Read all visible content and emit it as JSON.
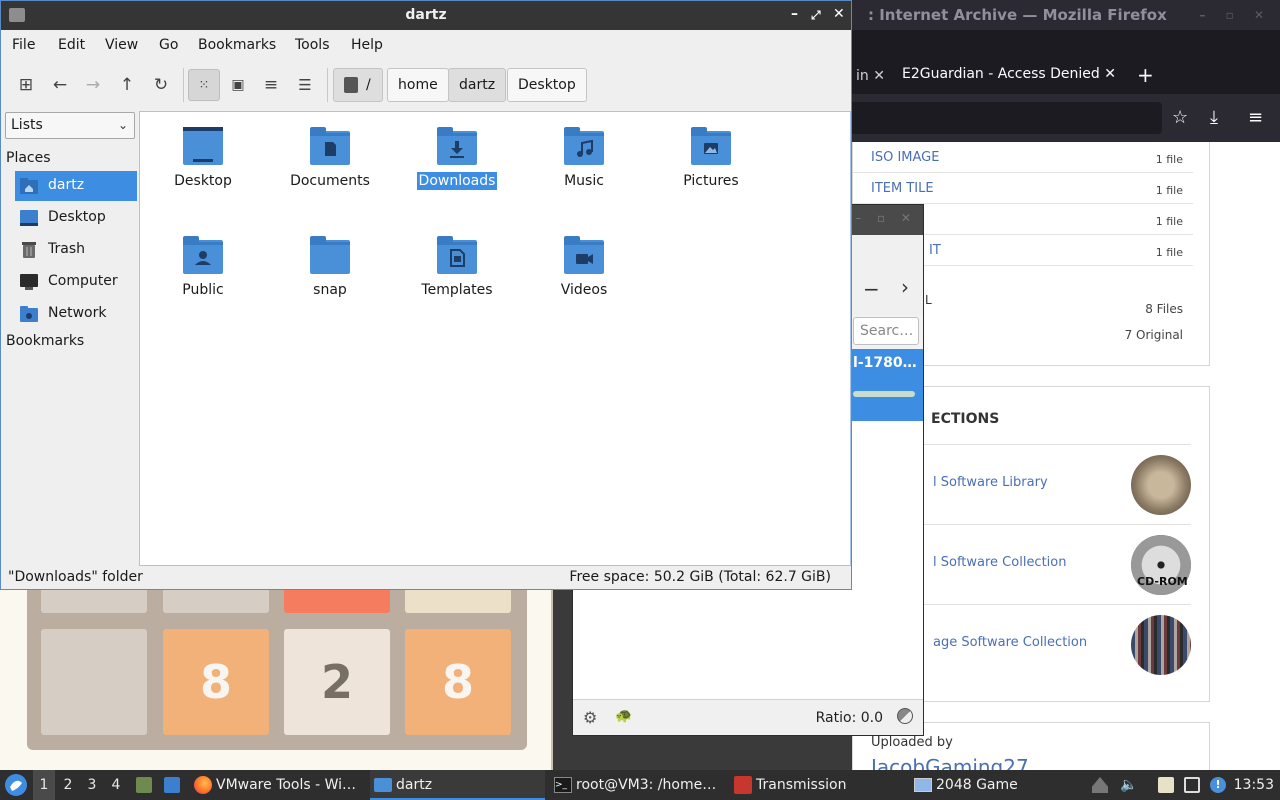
{
  "firefox": {
    "title": ": Internet Archive — Mozilla Firefox",
    "tab_prev_label": "in",
    "tab_active_label": "E2Guardian - Access Denied",
    "new_tab_glyph": "+",
    "files": [
      {
        "name": "ISO IMAGE",
        "count": "1 file"
      },
      {
        "name": "ITEM TILE",
        "count": "1 file"
      },
      {
        "name": "",
        "count": "1 file"
      },
      {
        "name": "IT",
        "count": "1 file"
      }
    ],
    "files_total_label": "L",
    "files_total": "8 Files",
    "files_original": "7 Original",
    "collections_title": "ECTIONS",
    "collections": [
      {
        "name": "l Software Library"
      },
      {
        "name": "l Software Collection"
      },
      {
        "name": "age Software Collection"
      }
    ],
    "cdrom_label": "CD-ROM",
    "uploaded_by_label": "Uploaded by",
    "uploader": "JacobGaming27"
  },
  "transmission": {
    "search_placeholder": "Searc…",
    "torrent_name": "l-1780…",
    "torrent_progress": 1.0,
    "ratio_text": "Ratio: 0.0"
  },
  "game": {
    "tiles_row2": [
      "",
      "8",
      "2",
      "8"
    ]
  },
  "file_manager": {
    "title": "dartz",
    "menu": [
      "File",
      "Edit",
      "View",
      "Go",
      "Bookmarks",
      "Tools",
      "Help"
    ],
    "breadcrumb": [
      "/",
      "home",
      "dartz",
      "Desktop"
    ],
    "side_selector": "Lists",
    "places_heading": "Places",
    "bookmarks_heading": "Bookmarks",
    "places": [
      {
        "label": "dartz",
        "icon": "home-folder-icon",
        "selected": true
      },
      {
        "label": "Desktop",
        "icon": "desktop-icon",
        "selected": false
      },
      {
        "label": "Trash",
        "icon": "trash-icon",
        "selected": false
      },
      {
        "label": "Computer",
        "icon": "computer-icon",
        "selected": false
      },
      {
        "label": "Network",
        "icon": "network-icon",
        "selected": false
      }
    ],
    "folders": [
      {
        "label": "Desktop",
        "icon": "desktop-folder-icon"
      },
      {
        "label": "Documents",
        "icon": "documents-folder-icon"
      },
      {
        "label": "Downloads",
        "icon": "downloads-folder-icon",
        "selected": true
      },
      {
        "label": "Music",
        "icon": "music-folder-icon"
      },
      {
        "label": "Pictures",
        "icon": "pictures-folder-icon"
      },
      {
        "label": "Public",
        "icon": "public-folder-icon"
      },
      {
        "label": "snap",
        "icon": "folder-icon"
      },
      {
        "label": "Templates",
        "icon": "templates-folder-icon"
      },
      {
        "label": "Videos",
        "icon": "videos-folder-icon"
      }
    ],
    "status_left": "\"Downloads\" folder",
    "status_right": "Free space: 50.2 GiB (Total: 62.7 GiB)"
  },
  "taskbar": {
    "workspaces": [
      "1",
      "2",
      "3",
      "4"
    ],
    "tasks": [
      {
        "label": "VMware Tools - Wi…",
        "icon": "firefox-icon"
      },
      {
        "label": "dartz",
        "icon": "folder-icon",
        "active": true
      },
      {
        "label": "root@VM3: /home…",
        "icon": "terminal-icon"
      },
      {
        "label": "Transmission",
        "icon": "transmission-icon"
      },
      {
        "label": "2048 Game",
        "icon": "window-icon"
      }
    ],
    "clock": "13:53"
  },
  "colors": {
    "accent": "#3d8ee3",
    "folder_blue": "#4a90d9",
    "tile_8": "#f2b179",
    "tile_2": "#eee4da"
  }
}
